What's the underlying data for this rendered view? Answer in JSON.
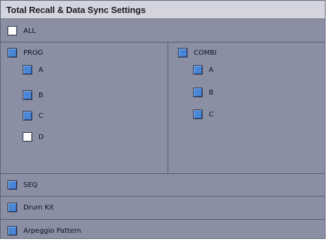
{
  "window": {
    "title": "Total Recall & Data Sync Settings"
  },
  "all": {
    "label": "ALL",
    "checked": false
  },
  "prog": {
    "label": "PROG",
    "checked": true,
    "banks": [
      {
        "label": "A",
        "checked": true
      },
      {
        "label": "B",
        "checked": true
      },
      {
        "label": "C",
        "checked": true
      },
      {
        "label": "D",
        "checked": false
      }
    ]
  },
  "combi": {
    "label": "COMBI",
    "checked": true,
    "banks": [
      {
        "label": "A",
        "checked": true
      },
      {
        "label": "B",
        "checked": true
      },
      {
        "label": "C",
        "checked": true
      }
    ]
  },
  "seq": {
    "label": "SEQ",
    "checked": true
  },
  "drum_kit": {
    "label": "Drum Kit",
    "checked": true
  },
  "arpeggio": {
    "label": "Arpeggio Pattern",
    "checked": true
  },
  "colors": {
    "checked": "#4a86d6",
    "unchecked": "#ffffff",
    "panel": "#8a8fa4",
    "title_bar": "#d3d4dd"
  }
}
